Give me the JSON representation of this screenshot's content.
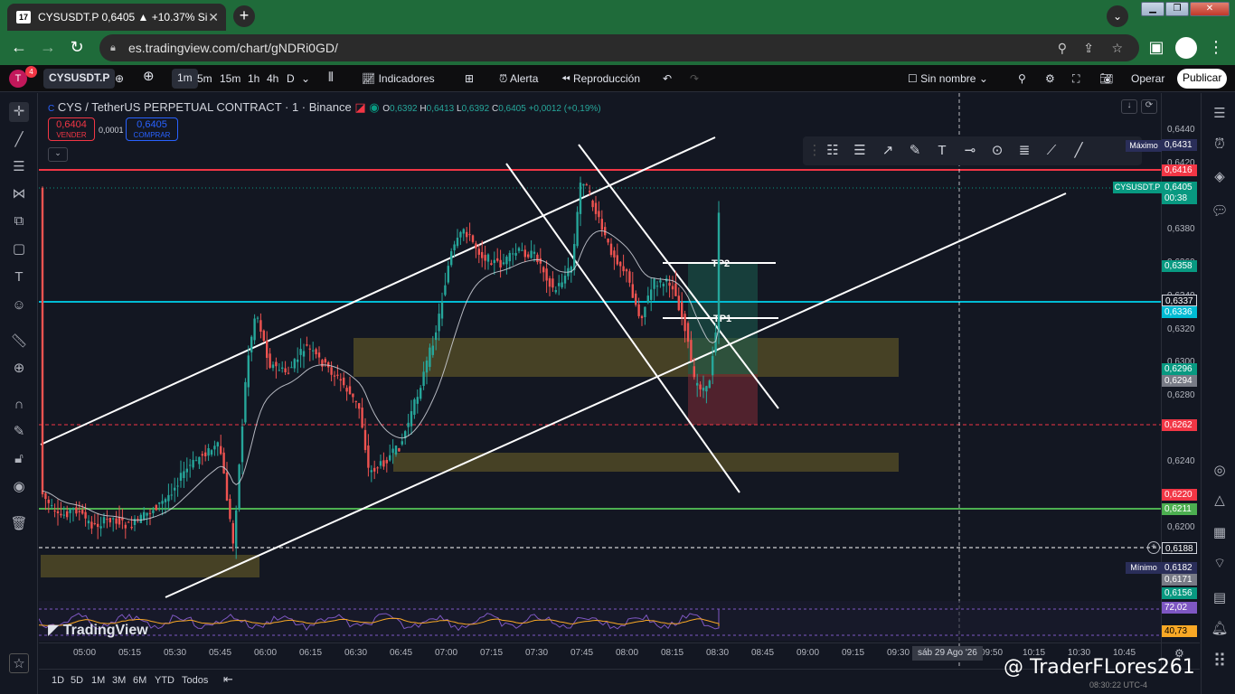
{
  "browser": {
    "tab_title": "CYSUSDT.P 0,6405 ▲ +10.37% Si",
    "favicon": "17",
    "url": "es.tradingview.com/chart/gNDRi0GD/"
  },
  "toolbar": {
    "badge": "4",
    "avatar": "T",
    "symbol": "CYSUSDT.P",
    "intervals": [
      "1m",
      "5m",
      "15m",
      "1h",
      "4h",
      "D"
    ],
    "indicators": "Indicadores",
    "alert": "Alerta",
    "replay": "Reproducción",
    "layout_name": "Sin nombre",
    "trade": "Operar",
    "publish": "Publicar"
  },
  "legend": {
    "title": "CYS / TetherUS PERPETUAL CONTRACT · 1 · Binance",
    "o": "0,6392",
    "h": "0,6413",
    "l": "0,6392",
    "c": "0,6405",
    "chg": "+0,0012 (+0,19%)",
    "sell_price": "0,6404",
    "sell_label": "VENDER",
    "spread": "0,0001",
    "buy_price": "0,6405",
    "buy_label": "COMPRAR"
  },
  "price_axis": {
    "ticks": [
      "0,6440",
      "0,6420",
      "0,6380",
      "0,6360",
      "0,6340",
      "0,6320",
      "0,6300",
      "0,6280",
      "0,6240",
      "0,6200"
    ],
    "labels": [
      {
        "text": "Máximo",
        "value": "0,6431",
        "color": "#2a2e59"
      },
      {
        "text": "",
        "value": "0,6416",
        "color": "#f23645"
      },
      {
        "text": "CYSUSDT.P",
        "value": "0,6405",
        "sub": "00:38",
        "color": "#089981"
      },
      {
        "text": "",
        "value": "0,6358",
        "color": "#089981"
      },
      {
        "text": "",
        "value": "0,6337",
        "color": "#131722"
      },
      {
        "text": "",
        "value": "0,6336",
        "color": "#00bcd4"
      },
      {
        "text": "",
        "value": "0,6296",
        "color": "#089981"
      },
      {
        "text": "",
        "value": "0,6294",
        "color": "#787b86"
      },
      {
        "text": "",
        "value": "0,6262",
        "color": "#f23645"
      },
      {
        "text": "",
        "value": "0,6220",
        "color": "#f23645"
      },
      {
        "text": "",
        "value": "0,6211",
        "color": "#4caf50"
      },
      {
        "text": "",
        "value": "0,6188",
        "color": "#131722"
      },
      {
        "text": "Mínimo",
        "value": "0,6182",
        "color": "#2a2e59"
      },
      {
        "text": "",
        "value": "0,6171",
        "color": "#787b86"
      },
      {
        "text": "",
        "value": "0,6156",
        "color": "#089981"
      },
      {
        "text": "",
        "value": "72,02",
        "color": "#7e57c2"
      },
      {
        "text": "",
        "value": "40,73",
        "color": "#f9a825"
      }
    ]
  },
  "time_axis": {
    "ticks": [
      "05:00",
      "05:15",
      "05:30",
      "05:45",
      "06:00",
      "06:15",
      "06:30",
      "06:45",
      "07:00",
      "07:15",
      "07:30",
      "07:45",
      "08:00",
      "08:15",
      "08:30",
      "08:45",
      "09:00",
      "09:15",
      "09:30",
      "09:50",
      "10:15",
      "10:30",
      "10:45"
    ],
    "cursor_label": "sáb 29 Ago '26"
  },
  "annotations": {
    "tp1": "TP1",
    "tp2": "TP2"
  },
  "watermark": "TradingView",
  "handle": "@ TraderFLores261",
  "clock": "08:30:22 UTC-4",
  "range_buttons": [
    "1D",
    "5D",
    "1M",
    "3M",
    "6M",
    "YTD",
    "Todos"
  ],
  "colors": {
    "up": "#26a69a",
    "down": "#ef5350",
    "resistance": "#f23645",
    "support_cyan": "#00bcd4",
    "support_green": "#4caf50",
    "zone": "#5c5426"
  }
}
